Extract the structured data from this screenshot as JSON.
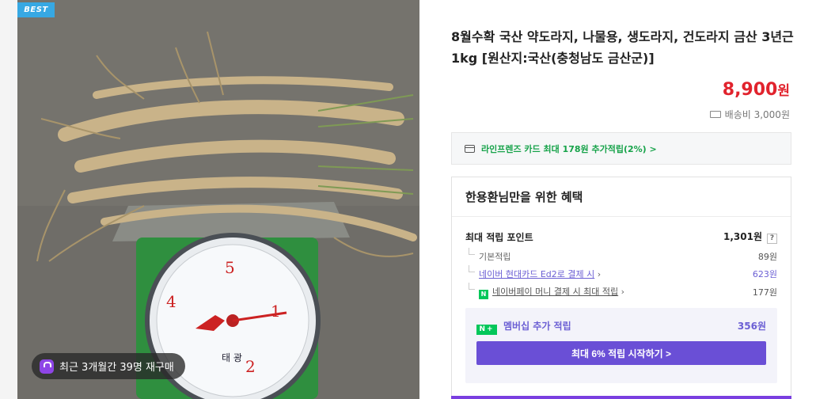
{
  "badge": {
    "best": "BEST"
  },
  "photo": {
    "repurchase_text": "최근 3개월간 39명 재구매",
    "scale_brand": "태 광",
    "scale_numbers": [
      "5",
      "4",
      "1",
      "2"
    ]
  },
  "product": {
    "title": "8월수확 국산 약도라지, 나물용, 생도라지, 건도라지 금산 3년근 1kg [원산지:국산(충청남도 금산군)]",
    "price": "8,900",
    "price_unit": "원",
    "shipping": "배송비 3,000원"
  },
  "card_promo": {
    "text": "라인프렌즈 카드 최대 178원 추가적립(2%) >"
  },
  "benefits": {
    "heading": "한용환님만을 위한 혜택",
    "max_label": "최대 적립 포인트",
    "max_value": "1,301원",
    "help": "?",
    "items": [
      {
        "label": "기본적립",
        "value": "89원"
      },
      {
        "label": "네이버 현대카드 Ed2로 결제 시",
        "value": "623원"
      },
      {
        "label": "네이버페이 머니 결제 시 최대 적립",
        "value": "177원"
      }
    ],
    "npay_icon": "N",
    "nplus_icon": "N+",
    "member_label": "멤버십 추가 적립",
    "member_value": "356원",
    "start_button": "최대 6% 적립 시작하기 >"
  },
  "colors": {
    "price": "#e1232d",
    "accent": "#6a4fd6",
    "green": "#03c75a",
    "badge": "#37a8e3"
  }
}
